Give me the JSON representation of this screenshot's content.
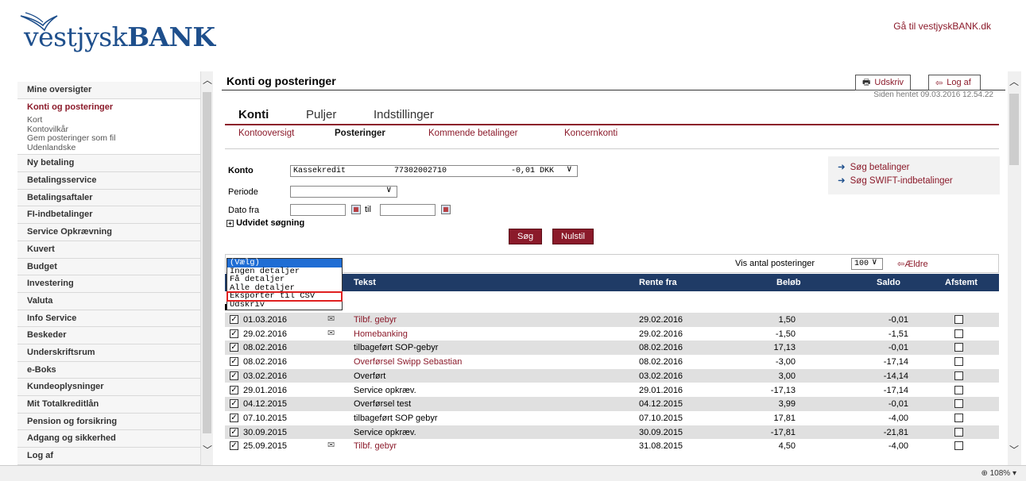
{
  "header": {
    "logo_text_prefix": "vestjysk",
    "logo_text_bold": "BANK",
    "goto_link": "Gå til vestjyskBANK.dk"
  },
  "sidebar": {
    "items": [
      {
        "label": "Mine oversigter",
        "active": false
      },
      {
        "label": "Konti og posteringer",
        "active": true,
        "sub": [
          "Kort",
          "Kontovilkår",
          "Gem posteringer som fil",
          "Udenlandske"
        ]
      },
      {
        "label": "Ny betaling"
      },
      {
        "label": "Betalingsservice"
      },
      {
        "label": "Betalingsaftaler"
      },
      {
        "label": "FI-indbetalinger"
      },
      {
        "label": "Service Opkrævning"
      },
      {
        "label": "Kuvert"
      },
      {
        "label": "Budget"
      },
      {
        "label": "Investering"
      },
      {
        "label": "Valuta"
      },
      {
        "label": "Info Service"
      },
      {
        "label": "Beskeder"
      },
      {
        "label": "Underskriftsrum"
      },
      {
        "label": "e-Boks"
      },
      {
        "label": "Kundeoplysninger"
      },
      {
        "label": "Mit Totalkreditlån"
      },
      {
        "label": "Pension og forsikring"
      },
      {
        "label": "Adgang og sikkerhed"
      },
      {
        "label": "Log af"
      }
    ]
  },
  "main": {
    "title": "Konti og posteringer",
    "print_label": "Udskriv",
    "logout_label": "Log af",
    "fetched": "Siden hentet 09.03.2016 12.54.22",
    "tabs": [
      "Konti",
      "Puljer",
      "Indstillinger"
    ],
    "subtabs": [
      "Kontooversigt",
      "Posteringer",
      "Kommende betalinger",
      "Koncernkonti"
    ],
    "form": {
      "konto_label": "Konto",
      "konto_name": "Kassekredit",
      "konto_number": "77302002710",
      "konto_balance": "-0,01 DKK",
      "periode_label": "Periode",
      "dato_fra_label": "Dato fra",
      "til_label": "til",
      "advanced": "Udvidet søgning",
      "search_btn": "Søg",
      "reset_btn": "Nulstil"
    },
    "quick_links": [
      "Søg betalinger",
      "Søg SWIFT-indbetalinger"
    ],
    "list": {
      "vis_label": "Vis antal posteringer",
      "count_value": "100",
      "older": "Ældre"
    },
    "dropdown_options": [
      "(Vælg)",
      "Ingen detaljer",
      "Få detaljer",
      "Alle detaljer",
      "Eksporter til CSV",
      "Udskriv"
    ],
    "columns": {
      "text": "Tekst",
      "rate_from": "Rente fra",
      "amount": "Beløb",
      "balance": "Saldo",
      "reconcile": "Afstemt"
    },
    "rows": [
      {
        "date": "01.03.2016",
        "mail": true,
        "text": "Tilbf. gebyr",
        "link": true,
        "rate": "29.02.2016",
        "amount": "1,50",
        "balance": "-0,01"
      },
      {
        "date": "29.02.2016",
        "mail": true,
        "text": "Homebanking",
        "link": true,
        "rate": "29.02.2016",
        "amount": "-1,50",
        "balance": "-1,51"
      },
      {
        "date": "08.02.2016",
        "mail": false,
        "text": "tilbageført SOP-gebyr",
        "link": false,
        "rate": "08.02.2016",
        "amount": "17,13",
        "balance": "-0,01"
      },
      {
        "date": "08.02.2016",
        "mail": false,
        "text": "Overførsel Swipp Sebastian",
        "link": true,
        "rate": "08.02.2016",
        "amount": "-3,00",
        "balance": "-17,14"
      },
      {
        "date": "03.02.2016",
        "mail": false,
        "text": "Overført",
        "link": false,
        "rate": "03.02.2016",
        "amount": "3,00",
        "balance": "-14,14"
      },
      {
        "date": "29.01.2016",
        "mail": false,
        "text": "Service opkræv.",
        "link": false,
        "rate": "29.01.2016",
        "amount": "-17,13",
        "balance": "-17,14"
      },
      {
        "date": "04.12.2015",
        "mail": false,
        "text": "Overførsel test",
        "link": false,
        "rate": "04.12.2015",
        "amount": "3,99",
        "balance": "-0,01"
      },
      {
        "date": "07.10.2015",
        "mail": false,
        "text": "tilbageført SOP gebyr",
        "link": false,
        "rate": "07.10.2015",
        "amount": "17,81",
        "balance": "-4,00"
      },
      {
        "date": "30.09.2015",
        "mail": false,
        "text": "Service opkræv.",
        "link": false,
        "rate": "30.09.2015",
        "amount": "-17,81",
        "balance": "-21,81"
      },
      {
        "date": "25.09.2015",
        "mail": true,
        "text": "Tilbf. gebyr",
        "link": true,
        "rate": "31.08.2015",
        "amount": "4,50",
        "balance": "-4,00"
      }
    ]
  },
  "status": {
    "zoom": "108%"
  },
  "colors": {
    "brand": "#8b1a2a",
    "header_blue": "#1f3b66",
    "logo_blue": "#1e4f8c"
  }
}
